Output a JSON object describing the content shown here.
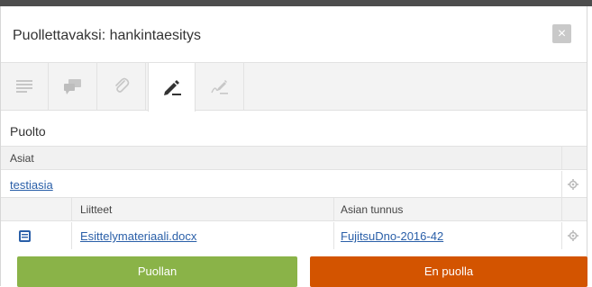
{
  "dialog": {
    "title": "Puollettavaksi: hankintaesitys"
  },
  "icons": {
    "close": "close-icon",
    "toolbar": [
      "list-icon",
      "comments-icon",
      "paperclip-icon",
      "pen-icon",
      "signature-icon"
    ],
    "settings": "gear-icon",
    "document": "document-icon"
  },
  "section": {
    "title": "Puolto"
  },
  "asiat": {
    "header": "Asiat",
    "item": "testiasia"
  },
  "attachments": {
    "headers": {
      "liitteet": "Liitteet",
      "asian_tunnus": "Asian tunnus"
    },
    "rows": [
      {
        "file": "Esittelymateriaali.docx",
        "code": "FujitsuDno-2016-42"
      }
    ]
  },
  "actions": {
    "approve": "Puollan",
    "reject": "En puolla"
  },
  "colors": {
    "approve": "#8ab348",
    "reject": "#d35400",
    "link": "#2a5fa8"
  }
}
